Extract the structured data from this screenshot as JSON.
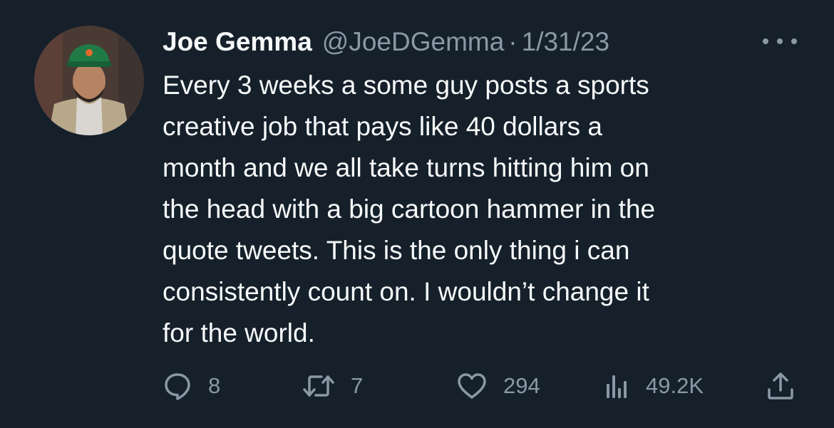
{
  "tweet": {
    "display_name": "Joe Gemma",
    "handle": "@JoeDGemma",
    "separator": "·",
    "date": "1/31/23",
    "text": "Every 3 weeks a some guy posts a sports\ncreative job that pays like 40 dollars a\nmonth and we all take turns hitting him on\nthe head with a big cartoon hammer in the\nquote tweets. This is the only thing i can\nconsistently count on. I wouldn’t change it\nfor the world.",
    "icons": {
      "avatar": "profile-photo",
      "more": "more-horizontal-icon",
      "reply": "speech-bubble-icon",
      "retweet": "retweet-arrows-icon",
      "like": "heart-icon",
      "views": "bar-chart-icon",
      "share": "share-upload-icon"
    },
    "stats": {
      "replies": "8",
      "retweets": "7",
      "likes": "294",
      "views": "49.2K"
    }
  },
  "colors": {
    "background": "#15202b",
    "primary_text": "#f7f9f9",
    "secondary_text": "#8b98a5"
  }
}
